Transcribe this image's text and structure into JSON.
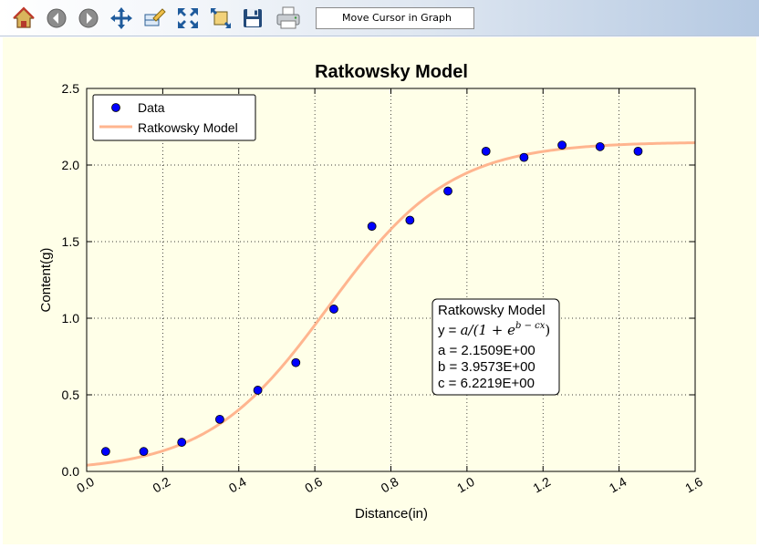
{
  "toolbar": {
    "buttons": [
      {
        "name": "home-icon",
        "title": "Home"
      },
      {
        "name": "back-icon",
        "title": "Back"
      },
      {
        "name": "forward-icon",
        "title": "Forward"
      },
      {
        "name": "pan-icon",
        "title": "Pan"
      },
      {
        "name": "edit-axes-icon",
        "title": "Edit"
      },
      {
        "name": "zoom-icon",
        "title": "Zoom"
      },
      {
        "name": "subplot-config-icon",
        "title": "Configure"
      },
      {
        "name": "save-icon",
        "title": "Save"
      },
      {
        "name": "print-icon",
        "title": "Print"
      }
    ],
    "status_text": "Move Cursor in Graph"
  },
  "colors": {
    "figure_bg": "#ffffe8",
    "data_marker": "#0000ff",
    "model_line": "#ffb58f"
  },
  "chart_data": {
    "type": "scatter",
    "title": "Ratkowsky Model",
    "xlabel": "Distance(in)",
    "ylabel": "Content(g)",
    "xlim": [
      0.0,
      1.6
    ],
    "ylim": [
      0.0,
      2.5
    ],
    "xticks": [
      0.0,
      0.2,
      0.4,
      0.6,
      0.8,
      1.0,
      1.2,
      1.4,
      1.6
    ],
    "xtick_labels": [
      "0.0",
      "0.2",
      "0.4",
      "0.6",
      "0.8",
      "1.0",
      "1.2",
      "1.4",
      "1.6"
    ],
    "yticks": [
      0.0,
      0.5,
      1.0,
      1.5,
      2.0,
      2.5
    ],
    "ytick_labels": [
      "0.0",
      "0.5",
      "1.0",
      "1.5",
      "2.0",
      "2.5"
    ],
    "grid": true,
    "legend_position": "top-left",
    "series": [
      {
        "name": "Data",
        "kind": "scatter",
        "x": [
          0.05,
          0.15,
          0.25,
          0.35,
          0.45,
          0.55,
          0.65,
          0.75,
          0.85,
          0.95,
          1.05,
          1.15,
          1.25,
          1.35,
          1.45
        ],
        "y": [
          0.13,
          0.13,
          0.19,
          0.34,
          0.53,
          0.71,
          1.06,
          1.6,
          1.64,
          1.83,
          2.09,
          2.05,
          2.13,
          2.12,
          2.09
        ]
      },
      {
        "name": "Ratkowsky Model",
        "kind": "line",
        "model": {
          "a": 2.1509,
          "b": 3.9573,
          "c": 6.2219
        }
      }
    ],
    "annotation": {
      "title": "Ratkowsky Model",
      "equation_prefix": "y = ",
      "equation": "a/(1 + e",
      "equation_exp": "b − cx",
      "equation_close": ")",
      "lines": [
        "a = 2.1509E+00",
        "b = 3.9573E+00",
        "c = 6.2219E+00"
      ]
    }
  }
}
